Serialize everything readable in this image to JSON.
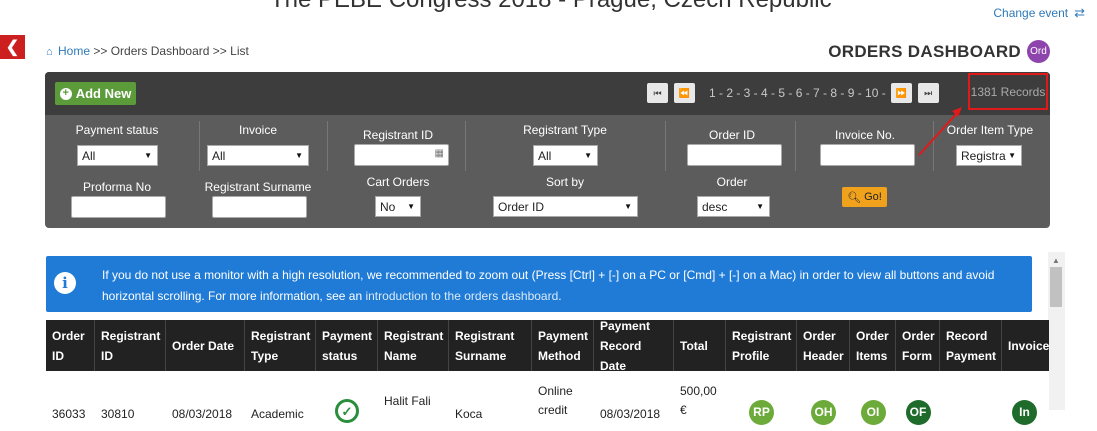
{
  "event_title": "The PEBE Congress 2018 - Prague, Czech Republic",
  "change_event": "Change event",
  "breadcrumb": {
    "home": "Home",
    "sep": ">>",
    "dashboard": "Orders Dashboard",
    "list": "List"
  },
  "page_title": "ORDERS DASHBOARD",
  "page_badge": "Ord",
  "add_new": "Add New",
  "pagination": {
    "pages": "1 - 2 - 3 - 4 - 5 - 6 - 7 - 8 - 9 - 10 -",
    "records": "1381 Records"
  },
  "filters": {
    "payment_status": {
      "label": "Payment status",
      "value": "All"
    },
    "invoice": {
      "label": "Invoice",
      "value": "All"
    },
    "registrant_id": {
      "label": "Registrant ID",
      "value": ""
    },
    "registrant_type": {
      "label": "Registrant Type",
      "value": "All"
    },
    "order_id": {
      "label": "Order ID",
      "value": ""
    },
    "invoice_no": {
      "label": "Invoice No.",
      "value": ""
    },
    "order_item_type": {
      "label": "Order Item Type",
      "value": "Registra"
    },
    "proforma_no": {
      "label": "Proforma No",
      "value": ""
    },
    "registrant_surname": {
      "label": "Registrant Surname",
      "value": ""
    },
    "cart_orders": {
      "label": "Cart Orders",
      "value": "No"
    },
    "sort_by": {
      "label": "Sort by",
      "value": "Order ID"
    },
    "order": {
      "label": "Order",
      "value": "desc"
    },
    "go": "Go!"
  },
  "info": {
    "text": "If you do not use a monitor with a high resolution, we recommended to zoom out (Press [Ctrl] + [-] on a PC or [Cmd] + [-] on a Mac) in order to view all buttons and avoid horizontal scrolling. For more information, see an",
    "link": "introduction to the orders dashboard",
    "end": "."
  },
  "table": {
    "headers": [
      "Order ID",
      "Registrant ID",
      "Order Date",
      "Registrant Type",
      "Payment status",
      "Registrant Name",
      "Registrant Surname",
      "Payment Method",
      "Payment Record Date",
      "Total",
      "Registrant Profile",
      "Order Header",
      "Order Items",
      "Order Form",
      "Record Payment",
      "Invoice"
    ],
    "row": {
      "order_id": "36033",
      "registrant_id": "30810",
      "order_date": "08/03/2018",
      "registrant_type": "Academic",
      "registrant_name": "Halit Fali",
      "registrant_surname": "Koca",
      "payment_method": "Online credit",
      "payment_record_date": "08/03/2018",
      "total": "500,00 €",
      "rp": "RP",
      "oh": "OH",
      "oi": "OI",
      "of": "OF",
      "in": "In"
    }
  },
  "colors": {
    "rp": "#6cab3a",
    "oh": "#6cab3a",
    "oi": "#6cab3a",
    "of": "#1e6b2c",
    "in": "#1e6b2c"
  }
}
